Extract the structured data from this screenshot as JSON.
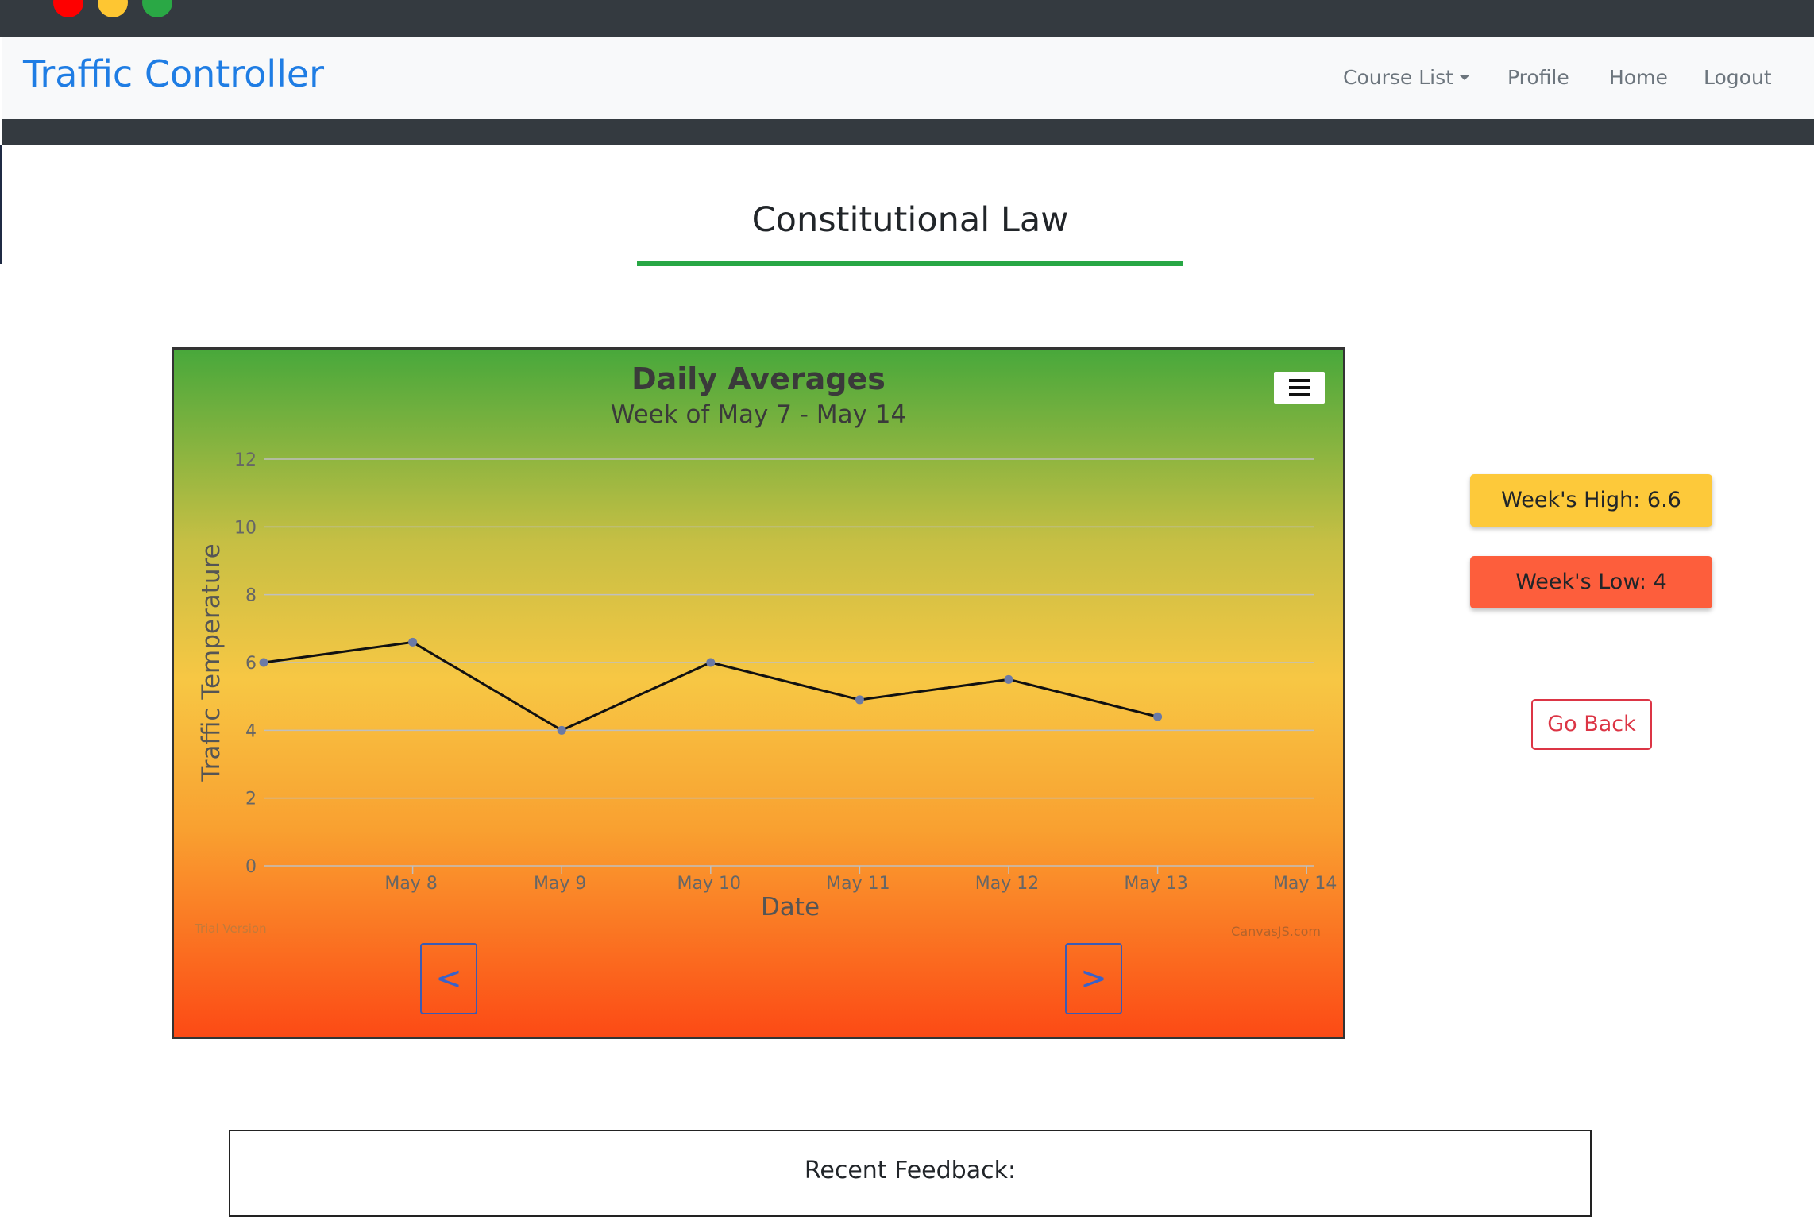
{
  "window": {
    "controls": [
      "close",
      "minimize",
      "zoom"
    ]
  },
  "navbar": {
    "brand": "Traffic Controller",
    "items": [
      {
        "label": "Course List",
        "dropdown": true
      },
      {
        "label": "Profile"
      },
      {
        "label": "Home"
      },
      {
        "label": "Logout"
      }
    ]
  },
  "course": {
    "title": "Constitutional Law"
  },
  "chart": {
    "menu_icon": "hamburger-menu-icon",
    "prev_label": "<",
    "next_label": ">",
    "trial_text": "Trial Version",
    "credit_text": "CanvasJS.com"
  },
  "chart_data": {
    "type": "line",
    "title": "Daily Averages",
    "subtitle": "Week of May 7 - May 14",
    "xlabel": "Date",
    "ylabel": "Traffic Temperature",
    "x_ticks": [
      "May 8",
      "May 9",
      "May 10",
      "May 11",
      "May 12",
      "May 13",
      "May 14"
    ],
    "ylim": [
      0,
      12
    ],
    "y_ticks": [
      0,
      2,
      4,
      6,
      8,
      10,
      12
    ],
    "series": [
      {
        "x": [
          "May 7",
          "May 8",
          "May 9",
          "May 10",
          "May 11",
          "May 12",
          "May 13"
        ],
        "values": [
          6.0,
          6.6,
          4.0,
          6.0,
          4.9,
          5.5,
          4.4
        ]
      }
    ],
    "grid": true,
    "background": "vertical gradient green to yellow to red"
  },
  "stats": {
    "high_label": "Week's High: 6.6",
    "low_label": "Week's Low: 4",
    "high_color": "#fdc93a",
    "low_color": "#fd5e3c"
  },
  "actions": {
    "go_back": "Go Back"
  },
  "feedback": {
    "title": "Recent Feedback:"
  },
  "colors": {
    "brand": "#1f7de4",
    "accent_rule": "#28a745",
    "danger": "#dc3545",
    "line": "#111111",
    "marker": "#6b7aa6"
  }
}
